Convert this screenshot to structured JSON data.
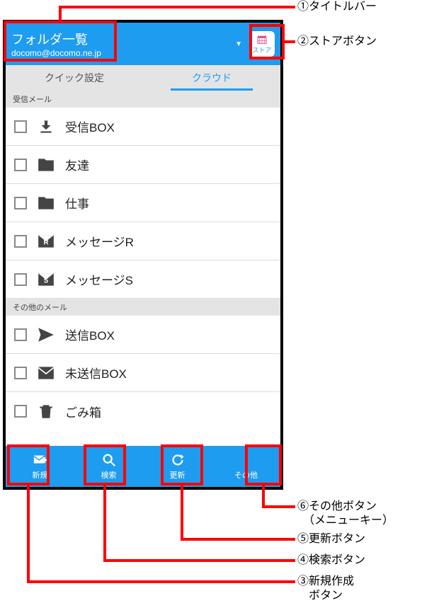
{
  "titlebar": {
    "title": "フォルダ一覧",
    "subtitle": "docomo@docomo.ne.jp",
    "store_label": "ストア"
  },
  "tabs": {
    "items": [
      {
        "label": "クイック設定",
        "active": false
      },
      {
        "label": "クラウド",
        "active": true
      }
    ]
  },
  "sections": [
    {
      "header": "受信メール",
      "items": [
        {
          "icon": "inbox",
          "label": "受信BOX"
        },
        {
          "icon": "folder",
          "label": "友達"
        },
        {
          "icon": "folder",
          "label": "仕事"
        },
        {
          "icon": "message-r",
          "label": "メッセージR"
        },
        {
          "icon": "message-s",
          "label": "メッセージS"
        }
      ]
    },
    {
      "header": "その他のメール",
      "items": [
        {
          "icon": "send",
          "label": "送信BOX"
        },
        {
          "icon": "draft",
          "label": "未送信BOX"
        },
        {
          "icon": "trash",
          "label": "ごみ箱"
        }
      ]
    }
  ],
  "bottombar": {
    "new_label": "新規",
    "search_label": "検索",
    "refresh_label": "更新",
    "more_label": "その他"
  },
  "annotations": {
    "a1": "①タイトルバー",
    "a2": "②ストアボタン",
    "a3": "③新規作成\n　ボタン",
    "a4": "④検索ボタン",
    "a5": "⑤更新ボタン",
    "a6": "⑥その他ボタン\n　（メニューキー）"
  },
  "colors": {
    "accent": "#1e9cf0",
    "annotation": "#f00"
  }
}
